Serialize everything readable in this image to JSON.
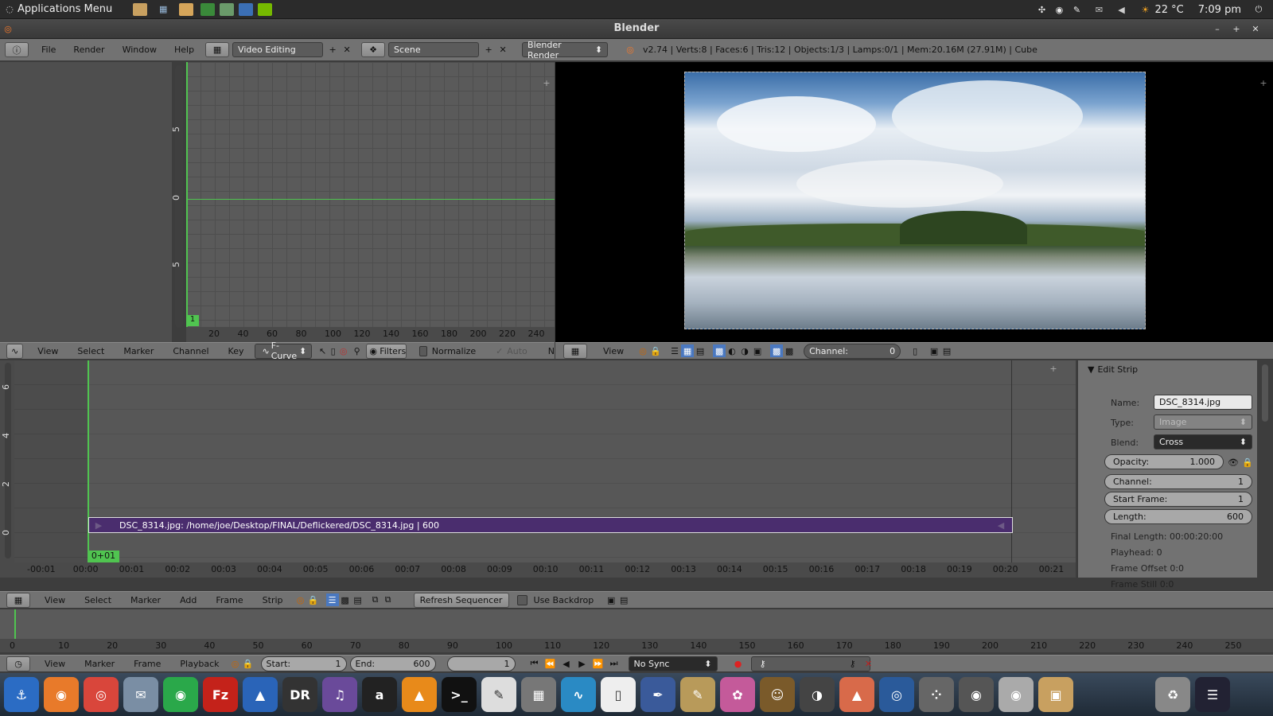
{
  "topbar": {
    "app_menu": "Applications Menu",
    "temp": "22 °C",
    "clock": "7:09 pm"
  },
  "window": {
    "title": "Blender"
  },
  "info": {
    "menus": [
      "File",
      "Render",
      "Window",
      "Help"
    ],
    "layout": "Video Editing",
    "scene": "Scene",
    "engine": "Blender Render",
    "stats": "v2.74 | Verts:8 | Faces:6 | Tris:12 | Objects:1/3 | Lamps:0/1 | Mem:20.16M (27.91M) | Cube"
  },
  "graph": {
    "yticks": [
      "5",
      "0",
      "5"
    ],
    "xticks": [
      "20",
      "40",
      "60",
      "80",
      "100",
      "120",
      "140",
      "160",
      "180",
      "200",
      "220",
      "240"
    ],
    "frame": "1",
    "header": {
      "menus": [
        "View",
        "Select",
        "Marker",
        "Channel",
        "Key"
      ],
      "mode": "F-Curve",
      "filters": "Filters",
      "normalize": "Normalize",
      "auto": "Auto",
      "n": "N"
    }
  },
  "preview": {
    "header": {
      "view": "View",
      "channel_label": "Channel:",
      "channel_value": "0"
    }
  },
  "sequencer": {
    "ytick": [
      "6",
      "4",
      "2",
      "0"
    ],
    "strip": "DSC_8314.jpg: /home/joe/Desktop/FINAL/Deflickered/DSC_8314.jpg | 600",
    "playhead": "0+01",
    "xticks": [
      "-00:01",
      "00:00",
      "00:01",
      "00:02",
      "00:03",
      "00:04",
      "00:05",
      "00:06",
      "00:07",
      "00:08",
      "00:09",
      "00:10",
      "00:11",
      "00:12",
      "00:13",
      "00:14",
      "00:15",
      "00:16",
      "00:17",
      "00:18",
      "00:19",
      "00:20",
      "00:21"
    ],
    "header": {
      "menus": [
        "View",
        "Select",
        "Marker",
        "Add",
        "Frame",
        "Strip"
      ],
      "refresh": "Refresh Sequencer",
      "backdrop": "Use Backdrop"
    }
  },
  "panel": {
    "title": "Edit Strip",
    "name_label": "Name:",
    "name": "DSC_8314.jpg",
    "type_label": "Type:",
    "type": "Image",
    "blend_label": "Blend:",
    "blend": "Cross",
    "opacity_label": "Opacity:",
    "opacity": "1.000",
    "channel_label": "Channel:",
    "channel": "1",
    "start_label": "Start Frame:",
    "start": "1",
    "length_label": "Length:",
    "length": "600",
    "final_length": "Final Length: 00:00:20:00",
    "playhead": "Playhead: 0",
    "offset": "Frame Offset 0:0",
    "still": "Frame Still 0:0"
  },
  "timeline": {
    "xticks": [
      "0",
      "10",
      "20",
      "30",
      "40",
      "50",
      "60",
      "70",
      "80",
      "90",
      "100",
      "110",
      "120",
      "130",
      "140",
      "150",
      "160",
      "170",
      "180",
      "190",
      "200",
      "210",
      "220",
      "230",
      "240",
      "250"
    ],
    "header": {
      "menus": [
        "View",
        "Marker",
        "Frame",
        "Playback"
      ],
      "start_label": "Start:",
      "start": "1",
      "end_label": "End:",
      "end": "600",
      "current": "1",
      "sync": "No Sync"
    }
  },
  "colors": {
    "accent": "#50c450",
    "strip": "#4a2d6e",
    "panel_bg": "#727272"
  }
}
